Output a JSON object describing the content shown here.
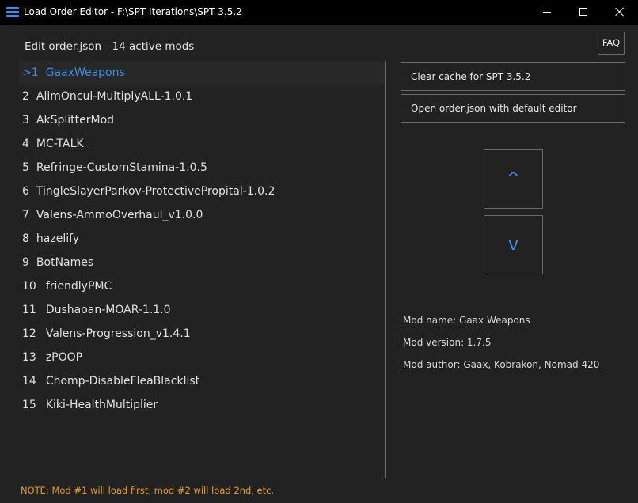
{
  "window": {
    "title": "Load Order Editor - F:\\SPT Iterations\\SPT 3.5.2",
    "icon": "hamburger-menu-icon",
    "controls": [
      "minimize-icon",
      "maximize-icon",
      "close-icon"
    ]
  },
  "header": {
    "text": "Edit order.json - 14 active mods",
    "faq_label": "FAQ"
  },
  "mods": [
    {
      "num": ">1",
      "name": "GaaxWeapons",
      "selected": true
    },
    {
      "num": "2",
      "name": "AlimOncul-MultiplyALL-1.0.1"
    },
    {
      "num": "3",
      "name": "AkSplitterMod"
    },
    {
      "num": "4",
      "name": "MC-TALK"
    },
    {
      "num": "5",
      "name": "Refringe-CustomStamina-1.0.5"
    },
    {
      "num": "6",
      "name": "TingleSlayerParkov-ProtectivePropital-1.0.2"
    },
    {
      "num": "7",
      "name": "Valens-AmmoOverhaul_v1.0.0"
    },
    {
      "num": "8",
      "name": "hazelify"
    },
    {
      "num": "9",
      "name": "BotNames"
    },
    {
      "num": "10",
      "name": "friendlyPMC"
    },
    {
      "num": "11",
      "name": "Dushaoan-MOAR-1.1.0"
    },
    {
      "num": "12",
      "name": "Valens-Progression_v1.4.1"
    },
    {
      "num": "13",
      "name": "zPOOP"
    },
    {
      "num": "14",
      "name": "Chomp-DisableFleaBlacklist"
    },
    {
      "num": "15",
      "name": "Kiki-HealthMultiplier"
    }
  ],
  "sidebar": {
    "clear_cache_label": "Clear cache for SPT 3.5.2",
    "open_editor_label": "Open order.json with default editor",
    "move_up_label": "^",
    "move_down_label": "v"
  },
  "info": {
    "name": "Mod name: Gaax Weapons",
    "version": "Mod version: 1.7.5",
    "author": "Mod author: Gaax, Kobrakon, Nomad 420"
  },
  "note": "NOTE: Mod #1 will load first, mod #2 will load 2nd, etc.",
  "colors": {
    "background": "#222222",
    "titlebar": "#000000",
    "accent": "#3d8ee6",
    "border": "#6a6a6a",
    "note": "#e8a020"
  }
}
